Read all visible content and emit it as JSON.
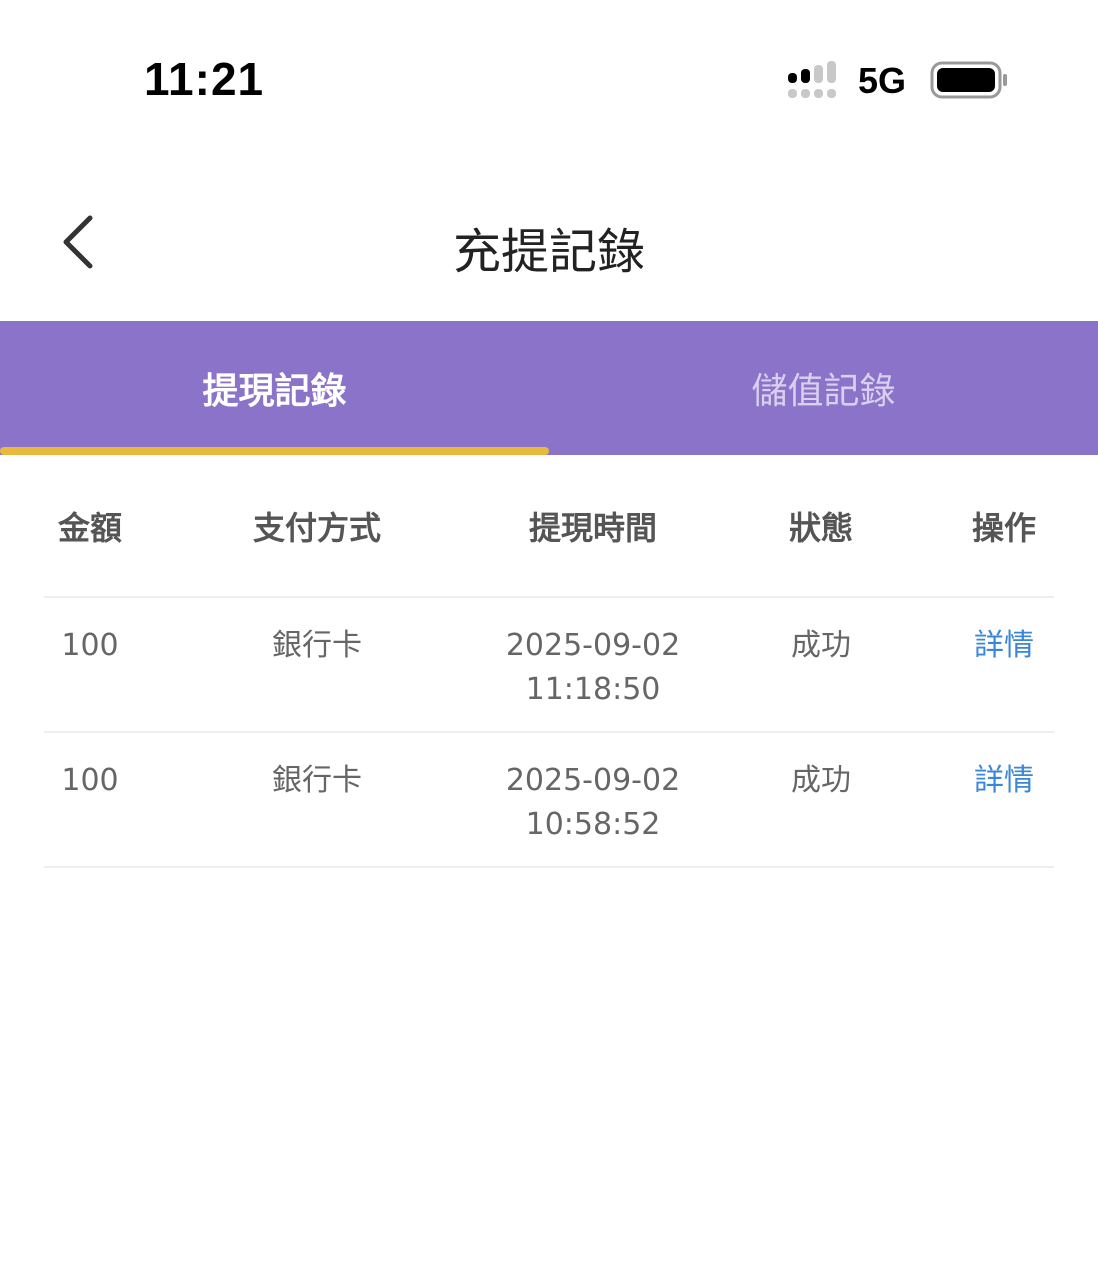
{
  "status_bar": {
    "time": "11:21",
    "network": "5G"
  },
  "nav": {
    "title": "充提記錄"
  },
  "tabs": [
    {
      "label": "提現記錄",
      "active": true
    },
    {
      "label": "儲值記錄",
      "active": false
    }
  ],
  "table": {
    "headers": [
      "金額",
      "支付方式",
      "提現時間",
      "狀態",
      "操作"
    ],
    "rows": [
      {
        "amount": "100",
        "method": "銀行卡",
        "date": "2025-09-02",
        "time": "11:18:50",
        "status": "成功",
        "action": "詳情"
      },
      {
        "amount": "100",
        "method": "銀行卡",
        "date": "2025-09-02",
        "time": "10:58:52",
        "status": "成功",
        "action": "詳情"
      }
    ]
  },
  "colors": {
    "tab_bar": "#8b73c9",
    "tab_indicator": "#e8b93c",
    "link": "#3a86d8"
  }
}
